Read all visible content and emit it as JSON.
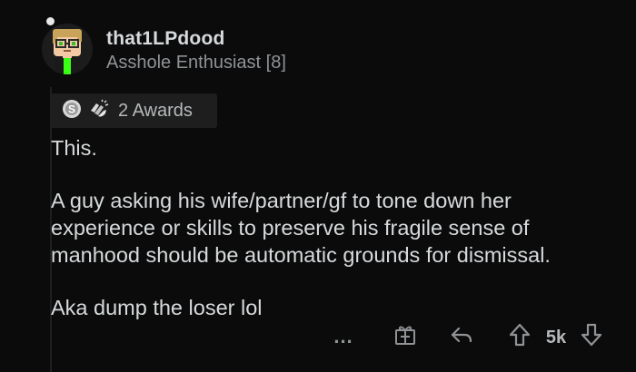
{
  "comment": {
    "username": "that1LPdood",
    "flair": "Asshole Enthusiast [8]",
    "awards_label": "2 Awards",
    "paragraphs": [
      "This.",
      "A guy asking his wife/partner/gf to tone down her experience or skills to preserve his fragile sense of manhood should be automatic grounds for dismissal.",
      "Aka dump the loser lol"
    ],
    "score": "5k",
    "more_label": "..."
  },
  "icons": {
    "award1": "silver-award-icon",
    "award2": "clapping-award-icon",
    "gift": "gift-icon",
    "reply": "reply-icon",
    "upvote": "upvote-arrow-icon",
    "downvote": "downvote-arrow-icon"
  },
  "colors": {
    "background": "#0b0b0b",
    "text": "#d7dadc",
    "muted": "#8f9396",
    "award_bg": "#1e1e1e"
  }
}
